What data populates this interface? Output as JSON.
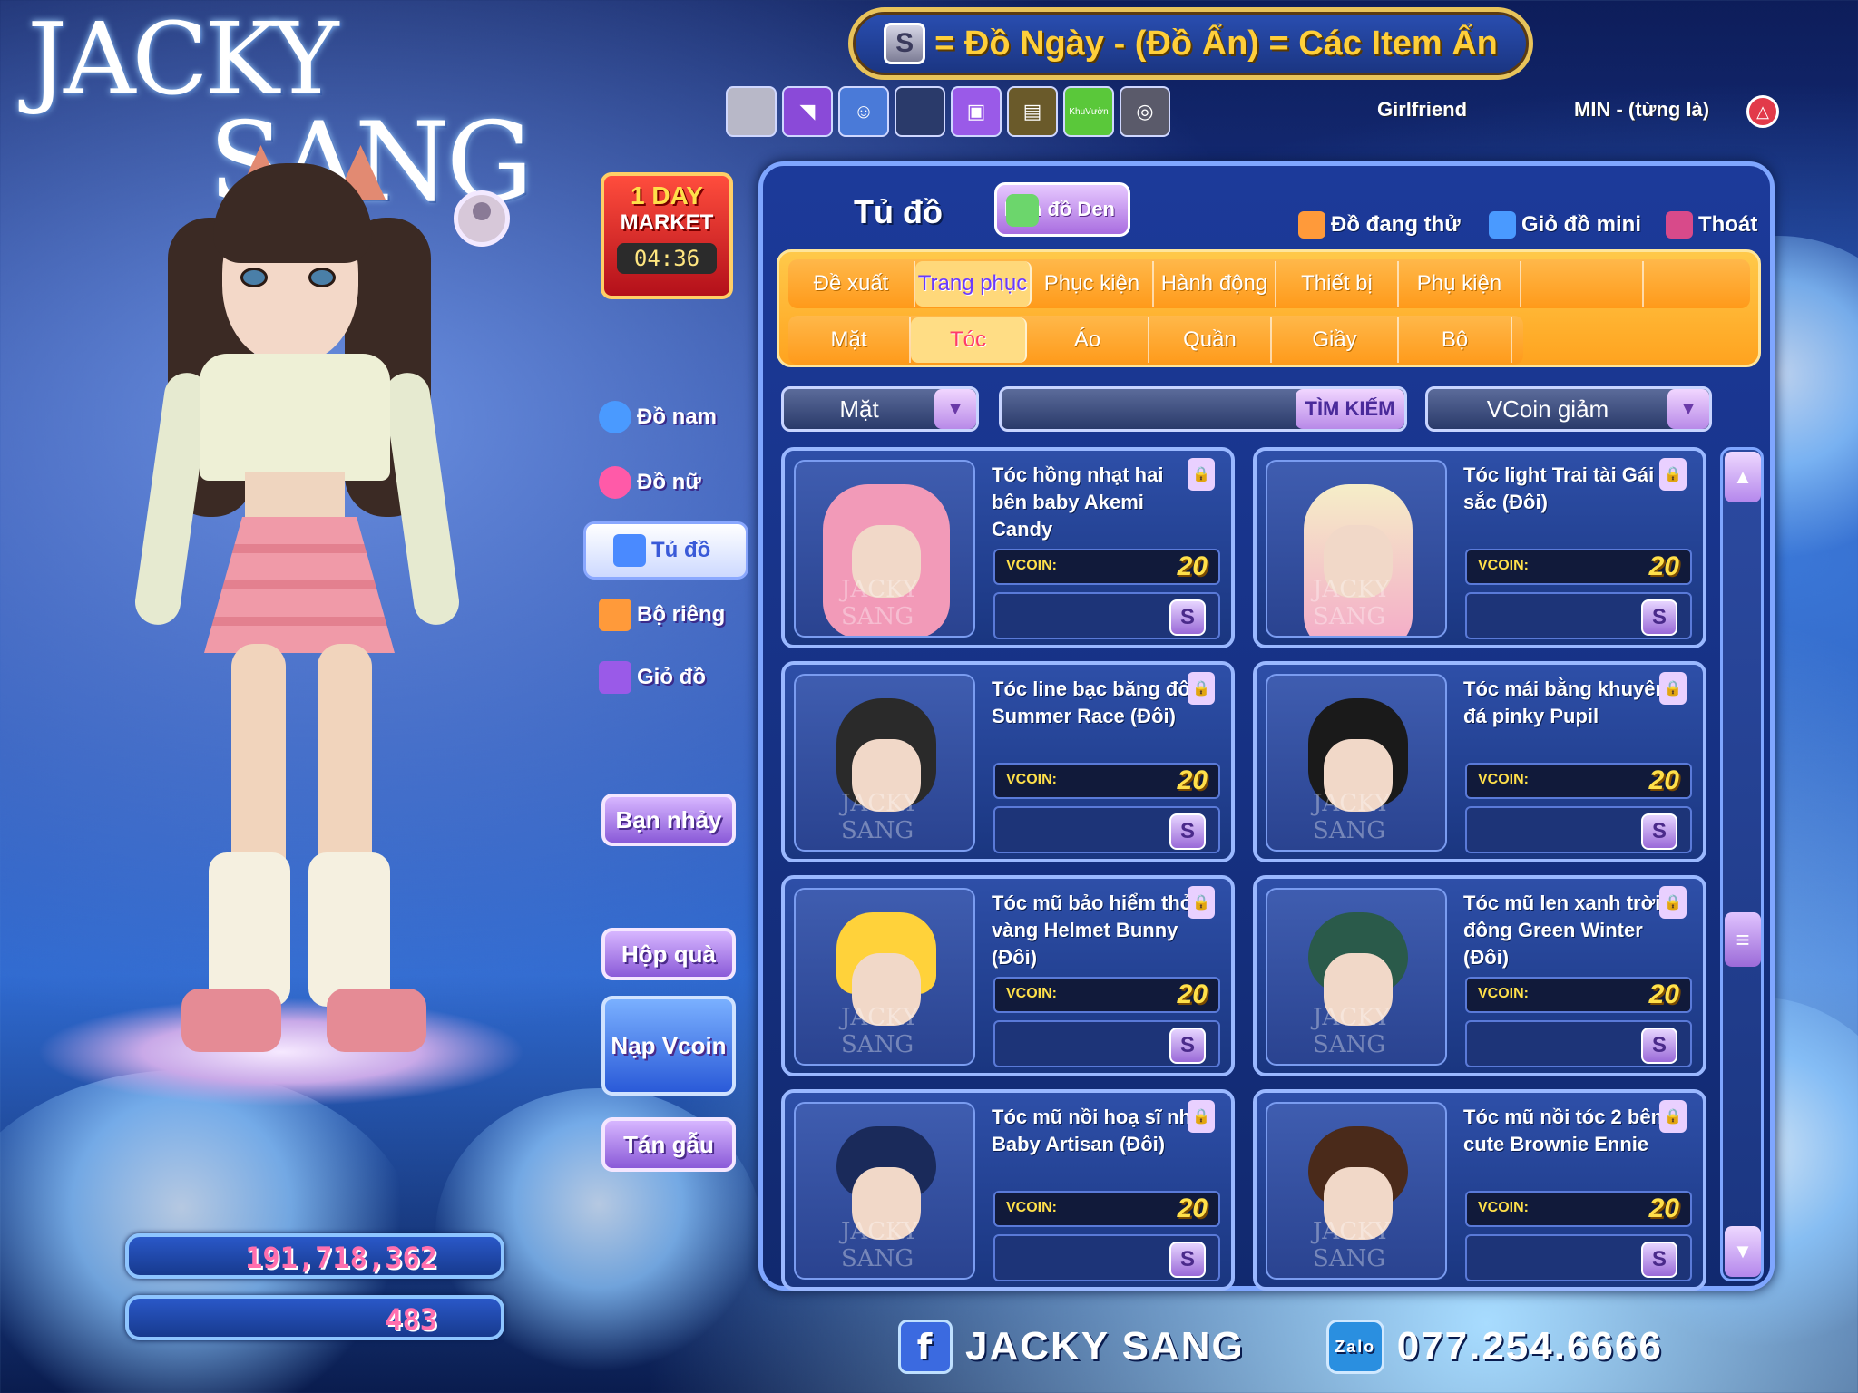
{
  "header": {
    "badge": "S",
    "text": "= Đồ Ngày - (Đồ Ẩn) = Các Item Ẩn"
  },
  "top_icons": [
    {
      "icon": "gray-box-icon",
      "color": "#b8b8c8",
      "label": ""
    },
    {
      "icon": "purple-horn-icon",
      "color": "#8a4ad8",
      "label": ""
    },
    {
      "icon": "pet-icon",
      "color": "#4a7ad8",
      "label": ""
    },
    {
      "icon": "dark-shape-icon",
      "color": "#2a3a6a",
      "label": ""
    },
    {
      "icon": "tv-icon",
      "color": "#9a5ae8",
      "label": ""
    },
    {
      "icon": "photo-icon",
      "color": "#6a5a2a",
      "label": ""
    },
    {
      "icon": "garden-icon",
      "color": "#5ac83a",
      "label": "KhuVườn"
    },
    {
      "icon": "gray-circle-icon",
      "color": "#5a5a6a",
      "label": ""
    }
  ],
  "status": {
    "girlfriend": "Girlfriend",
    "min": "MIN - (từng là)"
  },
  "market": {
    "title1": "1 DAY",
    "title2": "MARKET",
    "timer": "04:36"
  },
  "side_menu": [
    {
      "label": "Đồ nam",
      "icon": "male-icon",
      "color": "#4a9aff"
    },
    {
      "label": "Đồ nữ",
      "icon": "female-icon",
      "color": "#ff5aa8"
    },
    {
      "label": "Tủ đồ",
      "icon": "wardrobe-icon",
      "color": "#4a8aff"
    },
    {
      "label": "Bộ riêng",
      "icon": "set-icon",
      "color": "#ff9a3a"
    },
    {
      "label": "Giỏ đồ",
      "icon": "basket-icon",
      "color": "#9a5ae8"
    }
  ],
  "side_buttons": {
    "ban_nhay": "Bạn nhảy",
    "hop_qua": "Hộp quà",
    "nap_vcoin": "Nạp Vcoin",
    "tan_gau": "Tán gẫu"
  },
  "currency": {
    "gold": "191,718,362",
    "vcoin": "483"
  },
  "panel": {
    "title": "Tủ đồ",
    "ban_do_den": "Bán đồ Den",
    "links": {
      "dang_thu": "Đồ đang thử",
      "gio_mini": "Giỏ đồ mini",
      "thoat": "Thoát"
    }
  },
  "tabs_main": [
    "Đề xuất",
    "Trang phục",
    "Phục kiện",
    "Hành động",
    "Thiết bị",
    "Phụ kiện"
  ],
  "tabs_sub": [
    "Mặt",
    "Tóc",
    "Áo",
    "Quần",
    "Giầy",
    "Bộ"
  ],
  "filters": {
    "category": "Mặt",
    "search_placeholder": "",
    "search_button": "TÌM KIẾM",
    "sort": "VCoin giảm"
  },
  "items": [
    {
      "name": "Tóc hồng nhạt hai bên baby Akemi Candy",
      "price_label": "VCOIN:",
      "price": "20",
      "hair_color": "#f29ab8"
    },
    {
      "name": "Tóc light Trai tài Gái sắc (Đôi)",
      "price_label": "VCOIN:",
      "price": "20",
      "hair_color": "#f5eec8"
    },
    {
      "name": "Tóc line bạc băng đô Summer Race (Đôi)",
      "price_label": "VCOIN:",
      "price": "20",
      "hair_color": "#2a2a2a"
    },
    {
      "name": "Tóc mái bằng khuyên đá pinky Pupil",
      "price_label": "VCOIN:",
      "price": "20",
      "hair_color": "#1a1a1a"
    },
    {
      "name": "Tóc mũ bảo hiểm thỏ vàng Helmet Bunny (Đôi)",
      "price_label": "VCOIN:",
      "price": "20",
      "hair_color": "#ffd23a"
    },
    {
      "name": "Tóc mũ len xanh trời đông Green Winter (Đôi)",
      "price_label": "VCOIN:",
      "price": "20",
      "hair_color": "#2a5a4a"
    },
    {
      "name": "Tóc mũ nồi hoạ sĩ nhí Baby Artisan (Đôi)",
      "price_label": "VCOIN:",
      "price": "20",
      "hair_color": "#1a2a5a"
    },
    {
      "name": "Tóc mũ nồi tóc 2 bên cute Brownie Ennie",
      "price_label": "VCOIN:",
      "price": "20",
      "hair_color": "#4a2a1a"
    }
  ],
  "watermark": "JACKY SANG",
  "logo": {
    "line1": "JACKY",
    "line2": "SANG"
  },
  "footer": {
    "facebook": "JACKY SANG",
    "phone": "077.254.6666"
  },
  "colors": {
    "accent_orange": "#ffa31f",
    "price_yellow": "#ffe04a",
    "panel_blue": "#1c3a9a",
    "currency_pink": "#ff6fae"
  }
}
